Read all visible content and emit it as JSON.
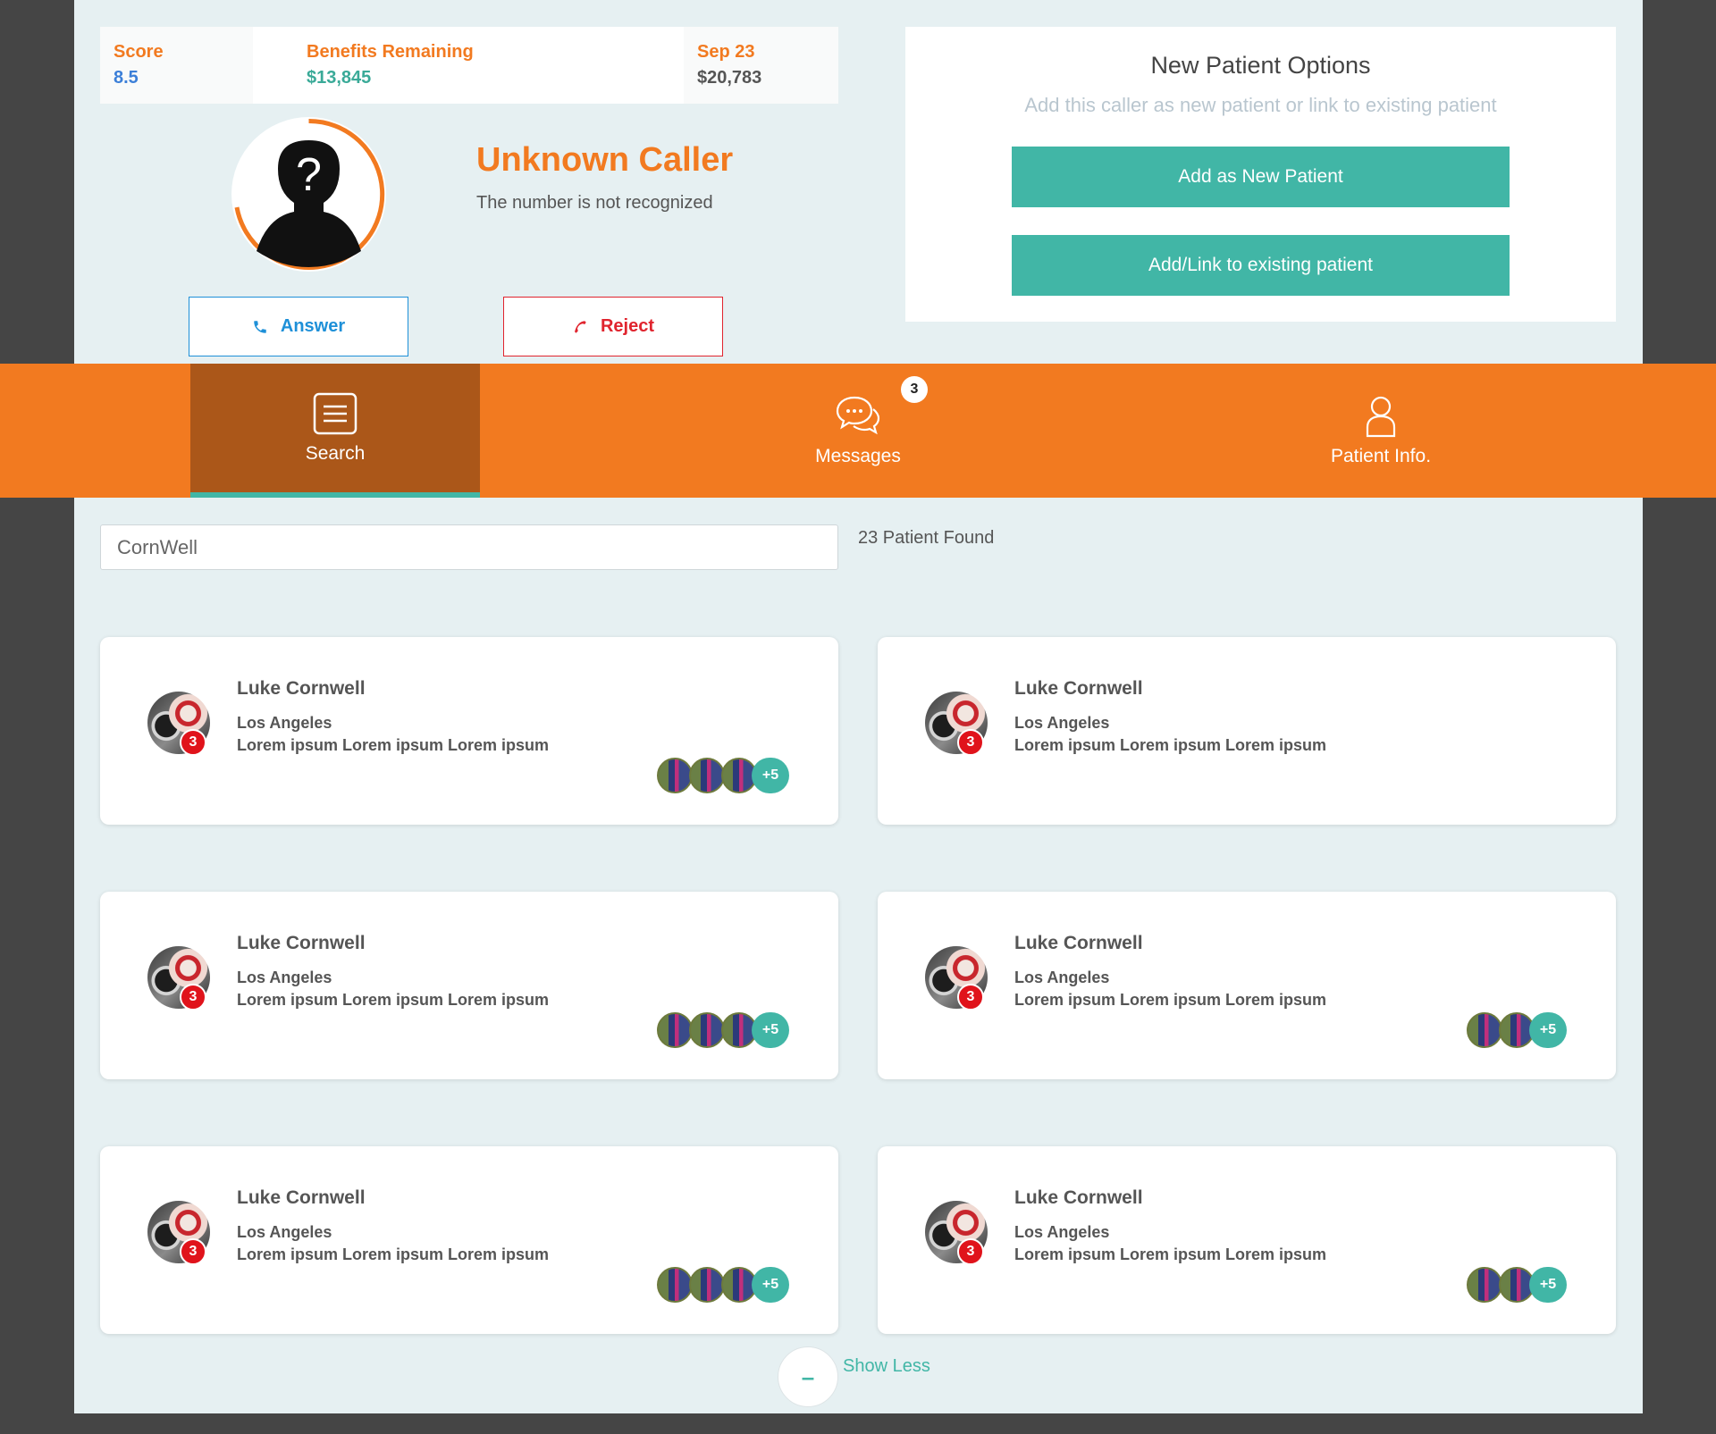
{
  "stats": [
    {
      "label": "Score",
      "value": "8.5",
      "value_color": "#3c7fd8"
    },
    {
      "label": "Benefits Remaining",
      "value": "$13,845",
      "value_color": "#3aaa98"
    },
    {
      "label": "Sep 23",
      "value": "$20,783",
      "value_color": "#555555"
    }
  ],
  "caller": {
    "name": "Unknown Caller",
    "subtitle": "The number is not recognized",
    "avatar_icon": "unknown-person-icon",
    "answer_label": "Answer",
    "reject_label": "Reject"
  },
  "new_patient": {
    "title": "New Patient Options",
    "subtitle": "Add this caller as new patient or link to existing patient",
    "add_new_label": "Add as New Patient",
    "link_existing_label": "Add/Link to existing patient"
  },
  "nav": {
    "items": [
      {
        "label": "Search",
        "icon": "list-icon",
        "active": true
      },
      {
        "label": "Messages",
        "icon": "chat-bubbles-icon",
        "badge": "3"
      },
      {
        "label": "Patient Info.",
        "icon": "person-icon"
      }
    ]
  },
  "search": {
    "value": "CornWell",
    "results_text": "23 Patient Found"
  },
  "patients": [
    {
      "name": "Luke Cornwell",
      "city": "Los Angeles",
      "desc": "Lorem ipsum Lorem ipsum Lorem ipsum",
      "badge": "3",
      "more": "+5"
    },
    {
      "name": "Luke Cornwell",
      "city": "Los Angeles",
      "desc": "Lorem ipsum Lorem ipsum Lorem ipsum",
      "badge": "3"
    },
    {
      "name": "Luke Cornwell",
      "city": "Los Angeles",
      "desc": "Lorem ipsum Lorem ipsum Lorem ipsum",
      "badge": "3",
      "more": "+5"
    },
    {
      "name": "Luke Cornwell",
      "city": "Los Angeles",
      "desc": "Lorem ipsum Lorem ipsum Lorem ipsum",
      "badge": "3",
      "more": "+5"
    },
    {
      "name": "Luke Cornwell",
      "city": "Los Angeles",
      "desc": "Lorem ipsum Lorem ipsum Lorem ipsum",
      "badge": "3",
      "more": "+5"
    },
    {
      "name": "Luke Cornwell",
      "city": "Los Angeles",
      "desc": "Lorem ipsum Lorem ipsum Lorem ipsum",
      "badge": "3",
      "more": "+5"
    }
  ],
  "show_less": {
    "symbol": "–",
    "label": "Show Less"
  },
  "colors": {
    "accent_orange": "#f27a20",
    "accent_teal": "#41b6a6",
    "nav_active": "#ab5719",
    "reject_red": "#e0242e",
    "answer_blue": "#1e90d8"
  }
}
